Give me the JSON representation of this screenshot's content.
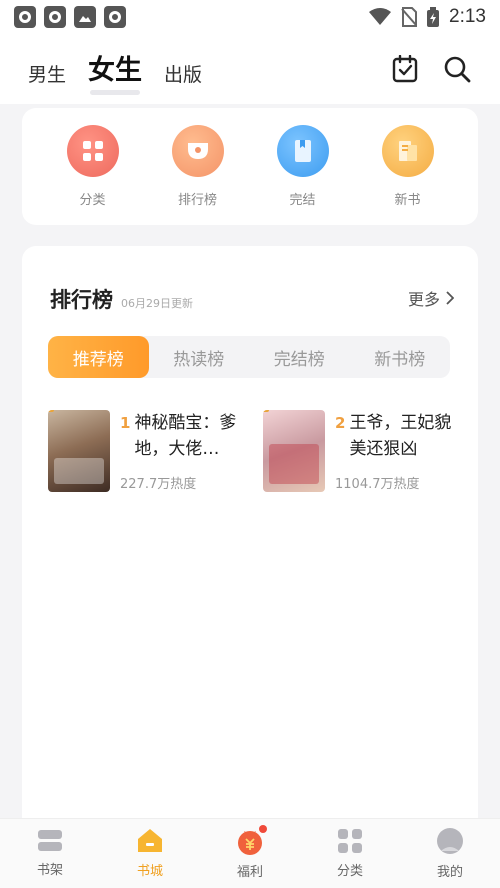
{
  "status_bar": {
    "time": "2:13",
    "icons": [
      "notification-icon",
      "notification-icon",
      "image-icon",
      "notification-icon",
      "wifi-icon",
      "no-sim-icon",
      "battery-icon"
    ]
  },
  "top_nav": {
    "tabs": [
      {
        "label": "男生",
        "active": false
      },
      {
        "label": "女生",
        "active": true
      },
      {
        "label": "出版",
        "active": false
      }
    ],
    "actions": [
      "checkin-icon",
      "search-icon"
    ]
  },
  "categories": [
    {
      "label": "分类",
      "icon": "grid-icon",
      "color": "#f06d5f"
    },
    {
      "label": "排行榜",
      "icon": "trophy-icon",
      "color": "#f69a6c"
    },
    {
      "label": "完结",
      "icon": "book-icon",
      "color": "#4aa6f0"
    },
    {
      "label": "新书",
      "icon": "newbook-icon",
      "color": "#f6b24b"
    }
  ],
  "ranking": {
    "title": "排行榜",
    "updated": "06月29日更新",
    "more": "更多",
    "tabs": [
      {
        "label": "推荐榜",
        "active": true
      },
      {
        "label": "热读榜",
        "active": false
      },
      {
        "label": "完结榜",
        "active": false
      },
      {
        "label": "新书榜",
        "active": false
      }
    ],
    "books": [
      {
        "rank": "1",
        "title": "神秘酷宝：爹地，大佬…",
        "heat": "227.7万热度"
      },
      {
        "rank": "2",
        "title": "王爷，王妃貌美还狠凶",
        "heat": "1104.7万热度"
      }
    ]
  },
  "bottom_nav": [
    {
      "label": "书架",
      "icon": "bookshelf-icon",
      "active": false
    },
    {
      "label": "书城",
      "icon": "home-icon",
      "active": true
    },
    {
      "label": "福利",
      "icon": "gift-icon",
      "active": false,
      "badge": true
    },
    {
      "label": "分类",
      "icon": "category-icon",
      "active": false
    },
    {
      "label": "我的",
      "icon": "profile-icon",
      "active": false
    }
  ],
  "colors": {
    "accent": "#f0a020",
    "rank_tab_active": "#ffa23a"
  }
}
